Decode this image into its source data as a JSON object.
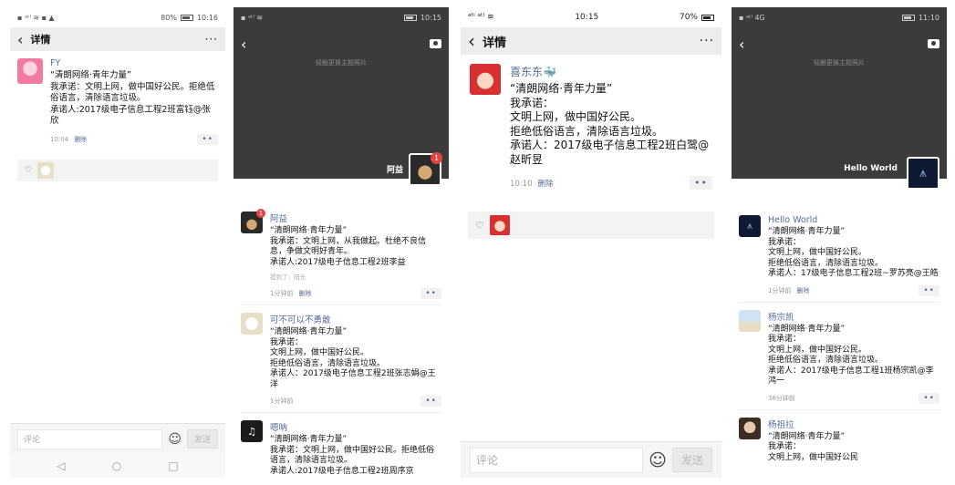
{
  "pledge_title": "“清朗网络·青年力量”",
  "panel1": {
    "status_left": "▪ ᵃᵗˡ ≋ ▪ ▲",
    "status_right": "80%",
    "time": "10:16",
    "nav_title": "详情",
    "more": "···",
    "post": {
      "name": "FY",
      "text": "我承诺：文明上网，做中国好公民。拒绝低俗语言，清除语言垃圾。\n承诺人:2017级电子信息工程2班富钰@张欣",
      "time": "10:04",
      "delete": "删除"
    },
    "comment_placeholder": "评论",
    "send": "发送",
    "sys_back": "◁",
    "sys_home": "○",
    "sys_recent": "□"
  },
  "panel2": {
    "status_left": "▪ ᵃᵗˡ ≋",
    "time": "10:15",
    "cover_hint": "轻触更换主题照片",
    "owner": "阿益",
    "owner_badge": "1",
    "posts": [
      {
        "name": "阿益",
        "badge": "1",
        "text": "“清朗网络·青年力量”\n我承诺：文明上网，从我做起。杜绝不良信息，争做文明好青年。\n承诺人:2017级电子信息工程2班李益",
        "sub": "提到了：阳光",
        "time": "1分钟前",
        "delete": "删除"
      },
      {
        "name": "可不可以不勇敢",
        "text": "“清朗网络·青年力量”\n我承诺：\n      文明上网，做中国好公民。\n      拒绝低俗语言，清除语言垃圾。\n承诺人：2017级电子信息工程2班张志娟@王洋",
        "time": "1分钟前"
      },
      {
        "name": "嗯呐",
        "text": "“清朗网络·青年力量”\n我承诺：文明上网，做中国好公民。拒绝低俗语言，清除语言垃圾。\n承诺人:2017级电子信息工程2班周序京"
      }
    ]
  },
  "panel3": {
    "status_left": "ᵃᵗˡ ᵃᵗˡ ≋",
    "time": "10:15",
    "status_right": "70%",
    "nav_title": "详情",
    "more": "···",
    "post": {
      "name": "喜东东🐳",
      "text": "“清朗网络·青年力量”\n我承诺：\n      文明上网，做中国好公民。\n      拒绝低俗语言，清除语言垃圾。\n承诺人：2017级电子信息工程2班白鹭@赵昕昱",
      "time": "10:10",
      "delete": "删除"
    },
    "comment_placeholder": "评论",
    "send": "发送"
  },
  "panel4": {
    "status_left": "▪ ᵃᵗˡ 4G",
    "time": "11:10",
    "cover_hint": "轻触更换主题照片",
    "owner": "Hello World",
    "posts": [
      {
        "name": "Hello World",
        "text": "“清朗网络·青年力量”\n我承诺：\n      文明上网，做中国好公民。\n      拒绝低俗语言，清除语言垃圾。\n承诺人：17级电子信息工程2班~罗苏亮@王皓",
        "time": "1分钟前",
        "delete": "删除"
      },
      {
        "name": "杨宗凯",
        "text": "“清朗网络·青年力量”\n我承诺：\n      文明上网，做中国好公民。\n      拒绝低俗语言，清除语言垃圾。\n承诺人：2017级电子信息工程1班杨宗凯@李鸿一",
        "time": "38分钟前"
      },
      {
        "name": "杨祖拉",
        "text": "“清朗网络·青年力量”\n我承诺：\n      文明上网，做中国好公民"
      }
    ]
  }
}
